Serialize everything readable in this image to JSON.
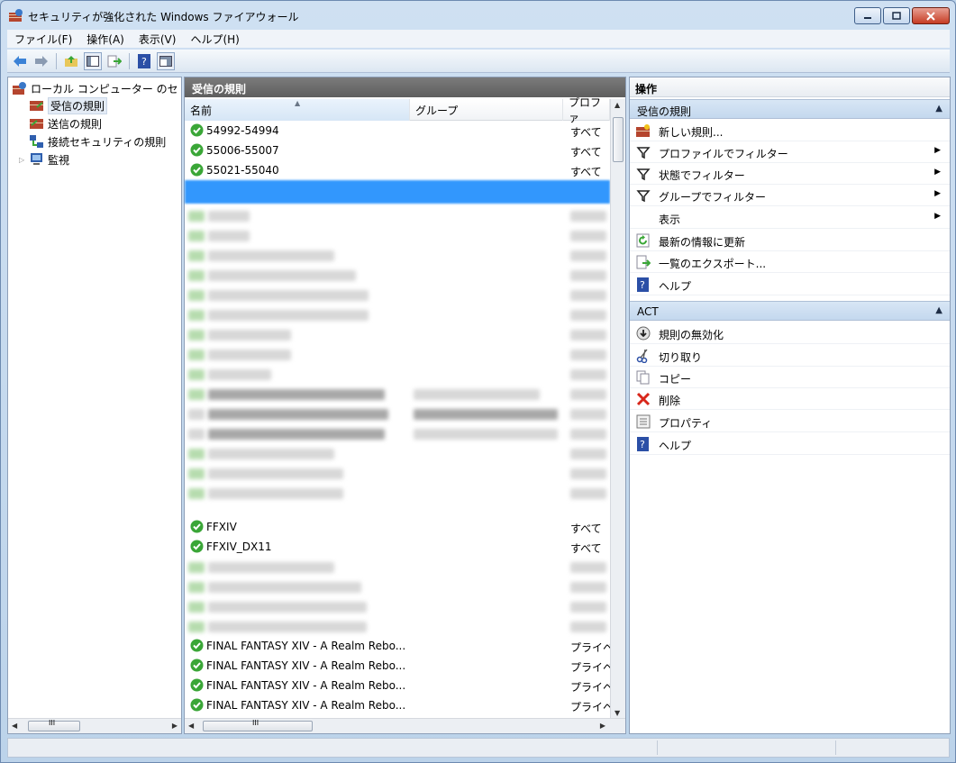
{
  "window": {
    "title": "セキュリティが強化された Windows ファイアウォール"
  },
  "menu": [
    "ファイル(F)",
    "操作(A)",
    "表示(V)",
    "ヘルプ(H)"
  ],
  "tree": {
    "root": "ローカル コンピューター のセ",
    "items": [
      "受信の規則",
      "送信の規則",
      "接続セキュリティの規則",
      "監視"
    ]
  },
  "middle": {
    "title": "受信の規則",
    "columns": [
      "名前",
      "グループ",
      "プロファ"
    ],
    "rows_top": [
      {
        "name": "54992-54994",
        "profile": "すべて"
      },
      {
        "name": "55006-55007",
        "profile": "すべて"
      },
      {
        "name": "55021-55040",
        "profile": "すべて"
      }
    ],
    "rows_mid": [
      {
        "name": "FFXIV",
        "profile": "すべて"
      },
      {
        "name": "FFXIV_DX11",
        "profile": "すべて"
      }
    ],
    "rows_bottom": [
      {
        "name": "FINAL FANTASY XIV - A Realm Rebo...",
        "profile": "プライベ"
      },
      {
        "name": "FINAL FANTASY XIV - A Realm Rebo...",
        "profile": "プライベ"
      },
      {
        "name": "FINAL FANTASY XIV - A Realm Rebo...",
        "profile": "プライベ"
      },
      {
        "name": "FINAL FANTASY XIV - A Realm Rebo...",
        "profile": "プライベ"
      }
    ]
  },
  "actions": {
    "title": "操作",
    "section1": {
      "label": "受信の規則",
      "items": [
        "新しい規則...",
        "プロファイルでフィルター",
        "状態でフィルター",
        "グループでフィルター",
        "表示",
        "最新の情報に更新",
        "一覧のエクスポート...",
        "ヘルプ"
      ]
    },
    "section2": {
      "label": "ACT",
      "items": [
        "規則の無効化",
        "切り取り",
        "コピー",
        "削除",
        "プロパティ",
        "ヘルプ"
      ]
    }
  },
  "colors": {
    "selection": "#3297fd",
    "check_green": "#3aa637",
    "accent_header": "#c4d8ee"
  }
}
